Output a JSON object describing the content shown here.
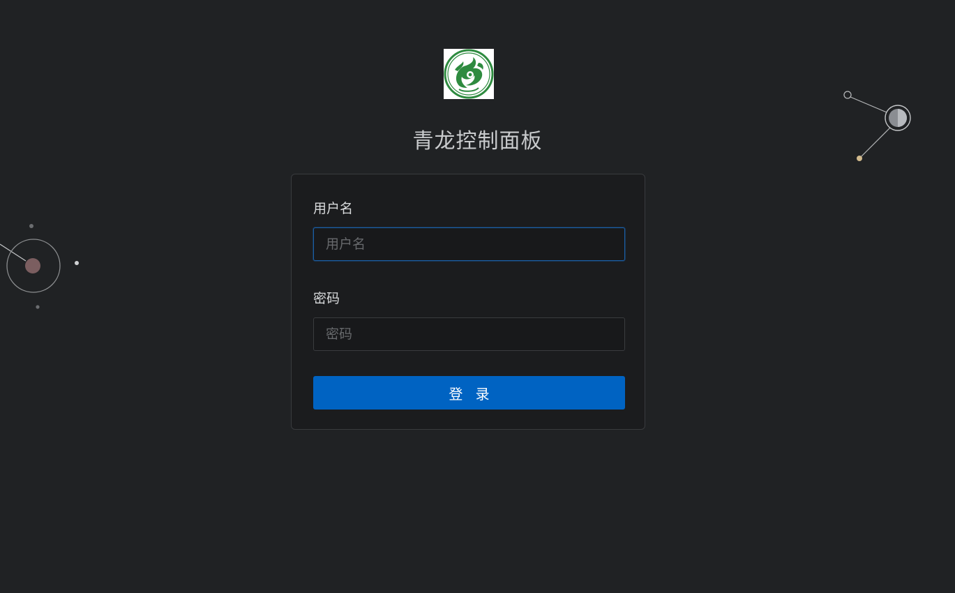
{
  "app": {
    "title": "青龙控制面板",
    "logo": "qinglong-dragon-logo"
  },
  "login_form": {
    "username_label": "用户名",
    "username_placeholder": "用户名",
    "username_value": "",
    "password_label": "密码",
    "password_placeholder": "密码",
    "password_value": "",
    "submit_label": "登 录"
  },
  "colors": {
    "background": "#202224",
    "card": "#1b1c1e",
    "primary": "#0063c2",
    "focus_border": "#1b5fa7",
    "logo_green": "#2e8b3f"
  }
}
